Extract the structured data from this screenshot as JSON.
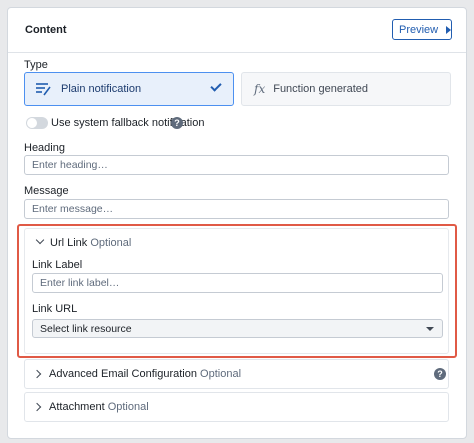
{
  "header": {
    "title": "Content",
    "preview_label": "Preview"
  },
  "type": {
    "label": "Type",
    "options": [
      {
        "label": "Plain notification",
        "selected": true
      },
      {
        "label": "Function generated",
        "selected": false
      }
    ],
    "fx_symbol": "fx"
  },
  "fallback": {
    "label": "Use system fallback notification",
    "enabled": false,
    "help": "?"
  },
  "heading": {
    "label": "Heading",
    "placeholder": "Enter heading…",
    "value": ""
  },
  "message": {
    "label": "Message",
    "placeholder": "Enter message…",
    "value": ""
  },
  "url_link": {
    "title": "Url Link",
    "optional": "Optional",
    "link_label": {
      "label": "Link Label",
      "placeholder": "Enter link label…",
      "value": ""
    },
    "link_url": {
      "label": "Link URL",
      "selected": "Select link resource"
    }
  },
  "advanced": {
    "title": "Advanced Email Configuration",
    "optional": "Optional",
    "help": "?"
  },
  "attachment": {
    "title": "Attachment",
    "optional": "Optional"
  },
  "colors": {
    "accent": "#215db0",
    "highlight_border": "#e05a46",
    "selected_bg": "#e8f0fb"
  },
  "icons": {
    "plain": "text-lines-icon",
    "function": "fx-icon",
    "check": "check-icon"
  }
}
